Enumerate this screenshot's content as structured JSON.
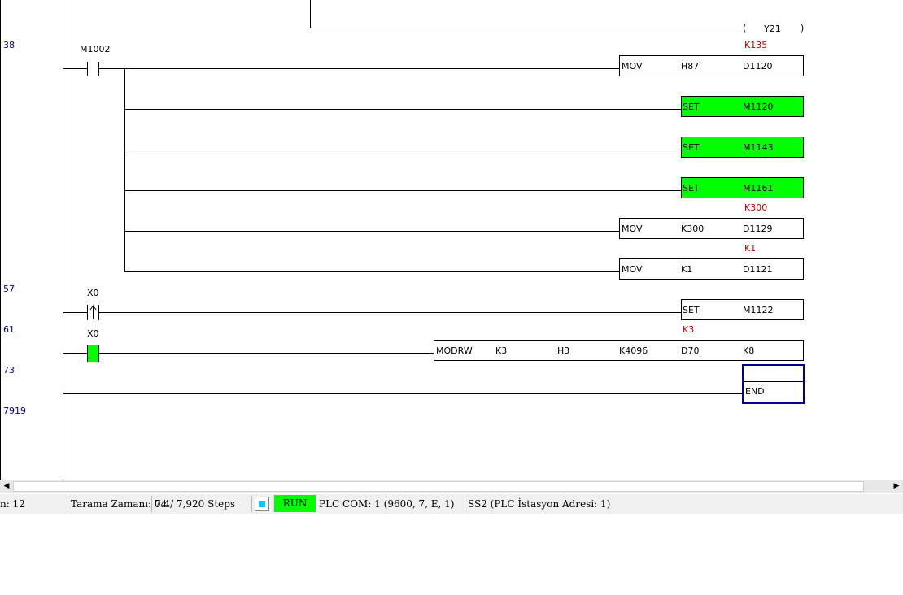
{
  "steps": [
    "38",
    "57",
    "61",
    "73",
    "7919"
  ],
  "top_coil": {
    "open": "(",
    "device": "Y21",
    "close": ")"
  },
  "rung38": {
    "contact": "M1002",
    "instructions": [
      {
        "const": "K135",
        "op": "MOV",
        "a": "H87",
        "b": "D1120"
      },
      {
        "op": "SET",
        "a": "M1120"
      },
      {
        "op": "SET",
        "a": "M1143"
      },
      {
        "op": "SET",
        "a": "M1161"
      },
      {
        "const": "K300",
        "op": "MOV",
        "a": "K300",
        "b": "D1129"
      },
      {
        "const": "K1",
        "op": "MOV",
        "a": "K1",
        "b": "D1121"
      }
    ]
  },
  "rung57": {
    "contact": "X0",
    "op": "SET",
    "a": "M1122"
  },
  "rung61": {
    "contact": "X0",
    "const": "K3",
    "op": "MODRW",
    "args": [
      "K3",
      "H3",
      "K4096",
      "D70",
      "K8"
    ]
  },
  "end_label": "END",
  "scrollbar": {
    "left": "◀",
    "right": "▶"
  },
  "status": {
    "line": "n: 12",
    "scan": "Tarama Zamanı: 0.4",
    "steps": "74 / 7,920 Steps",
    "run": "RUN",
    "com": "PLC COM: 1 (9600, 7, E, 1)",
    "station": "SS2 (PLC İstasyon Adresi: 1)"
  },
  "colors": {
    "active": "#00ff00",
    "constant": "#c00000",
    "step_number": "#00007f",
    "cursor": "#00008b"
  }
}
